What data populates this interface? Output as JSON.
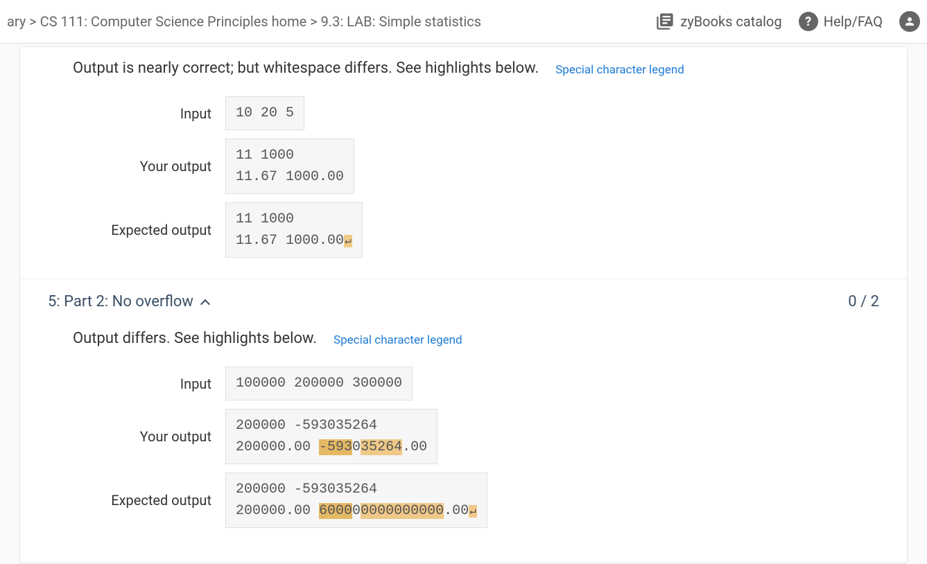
{
  "header": {
    "breadcrumb": "ary > CS 111: Computer Science Principles home > 9.3: LAB: Simple statistics",
    "catalog_label": "zyBooks catalog",
    "help_label": "Help/FAQ"
  },
  "section1": {
    "message": "Output is nearly correct; but whitespace differs. See highlights below.",
    "legend_link": "Special character legend",
    "input_label": "Input",
    "input_value": "10 20 5",
    "your_output_label": "Your output",
    "your_output_line1": "11 1000",
    "your_output_line2": "11.67 1000.00",
    "expected_output_label": "Expected output",
    "expected_output_line1": "11 1000",
    "expected_output_line2": "11.67 1000.00",
    "expected_newline": "↵"
  },
  "section2": {
    "title": "5: Part 2: No overflow",
    "score": "0 / 2",
    "message": "Output differs. See highlights below.",
    "legend_link": "Special character legend",
    "input_label": "Input",
    "input_value": "100000 200000 300000",
    "your_output_label": "Your output",
    "your_output_line1": "200000 -593035264",
    "your_output_line2_pre": "200000.00 ",
    "your_output_hl1": "-593",
    "your_output_mid": "0",
    "your_output_hl2": "35264",
    "your_output_post": ".00",
    "expected_output_label": "Expected output",
    "expected_output_line1": "200000 -593035264",
    "expected_output_line2_pre": "200000.00 ",
    "expected_output_hl1": "6000",
    "expected_output_mid": "0",
    "expected_output_hl2": "0000000000",
    "expected_output_post": ".00",
    "expected_newline": "↵"
  }
}
